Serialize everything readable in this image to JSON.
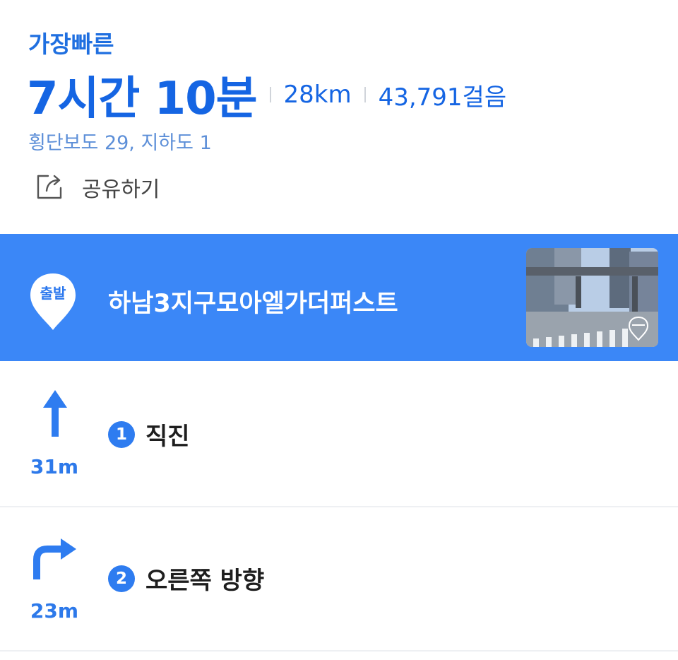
{
  "summary": {
    "route_type": "가장빠른",
    "duration": "7시간 10분",
    "distance": "28km",
    "steps_count": "43,791걸음",
    "crossings": "횡단보도 29, 지하도 1",
    "share_label": "공유하기"
  },
  "start": {
    "badge": "출발",
    "name": "하남3지구모아엘가더퍼스트",
    "accent_color": "#3b87f7"
  },
  "steps": [
    {
      "number": "1",
      "instruction": "직진",
      "distance": "31m",
      "icon": "arrow-up-icon"
    },
    {
      "number": "2",
      "instruction": "오른쪽 방향",
      "distance": "23m",
      "icon": "turn-right-icon"
    }
  ]
}
